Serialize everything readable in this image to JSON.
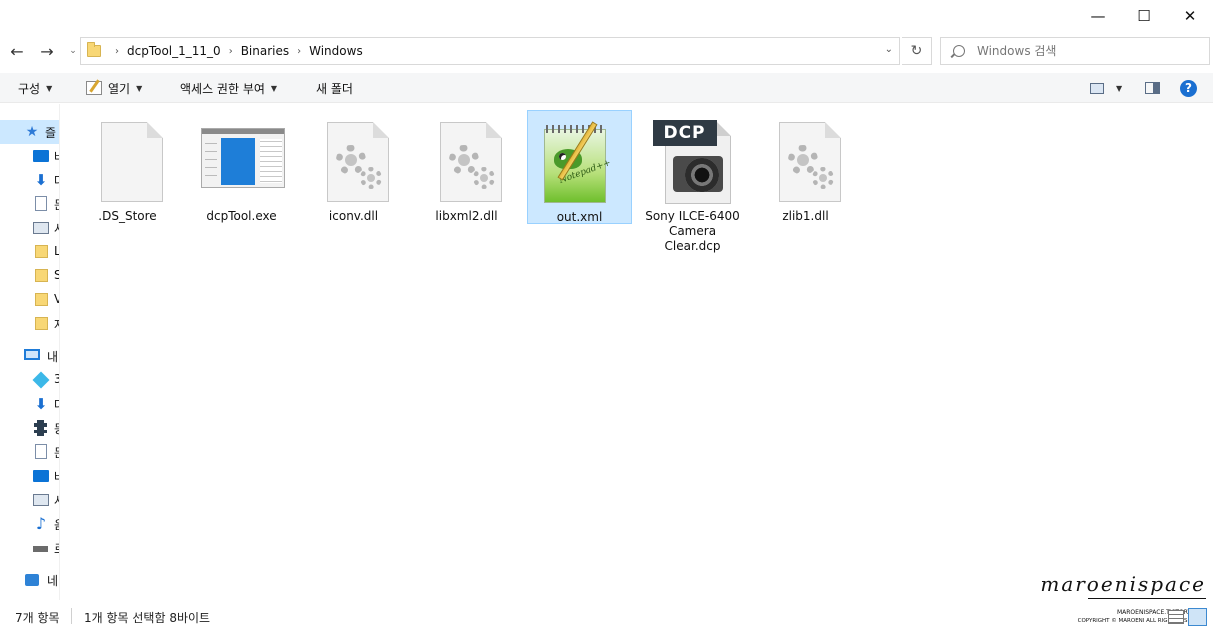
{
  "window": {
    "minimize_glyph": "—",
    "maximize_glyph": "☐",
    "close_glyph": "✕"
  },
  "nav": {
    "back_glyph": "←",
    "forward_glyph": "→",
    "recent_glyph": "⌄",
    "refresh_glyph": "↻",
    "dropdown_glyph": "⌄"
  },
  "address": {
    "breadcrumb": [
      "dcpTool_1_11_0",
      "Binaries",
      "Windows"
    ],
    "separator": "›"
  },
  "search": {
    "placeholder": "Windows 검색"
  },
  "toolbar": {
    "organize": "구성",
    "open": "열기",
    "access": "액세스 권한 부여",
    "new_folder": "새 폴더",
    "help": "?"
  },
  "sidebar": {
    "items": [
      {
        "label": "즐",
        "icon": "star-icon",
        "selected": true
      },
      {
        "label": "바",
        "icon": "desktop-icon"
      },
      {
        "label": "다",
        "icon": "download-icon"
      },
      {
        "label": "문",
        "icon": "document-icon"
      },
      {
        "label": "사",
        "icon": "pictures-icon"
      },
      {
        "label": "L",
        "icon": "folder-icon"
      },
      {
        "label": "S",
        "icon": "folder-icon"
      },
      {
        "label": "V",
        "icon": "folder-icon"
      },
      {
        "label": "자",
        "icon": "folder-icon"
      },
      {
        "label": "내",
        "icon": "computer-icon"
      },
      {
        "label": "3",
        "icon": "3d-objects-icon"
      },
      {
        "label": "다",
        "icon": "download-icon"
      },
      {
        "label": "동",
        "icon": "video-icon"
      },
      {
        "label": "문",
        "icon": "document-icon"
      },
      {
        "label": "바",
        "icon": "desktop-icon"
      },
      {
        "label": "사",
        "icon": "pictures-icon"
      },
      {
        "label": "음",
        "icon": "music-icon"
      },
      {
        "label": "로",
        "icon": "drive-icon"
      },
      {
        "label": "네",
        "icon": "network-icon"
      }
    ]
  },
  "files": [
    {
      "name": ".DS_Store",
      "icon": "blank-file-icon",
      "selected": false
    },
    {
      "name": "dcpTool.exe",
      "icon": "exe-icon",
      "selected": false
    },
    {
      "name": "iconv.dll",
      "icon": "dll-gear-icon",
      "selected": false
    },
    {
      "name": "libxml2.dll",
      "icon": "dll-gear-icon",
      "selected": false
    },
    {
      "name": "out.xml",
      "icon": "notepad-plus-plus-icon",
      "selected": true
    },
    {
      "name": "Sony ILCE-6400 Camera Clear.dcp",
      "icon": "dcp-camera-icon",
      "selected": false
    },
    {
      "name": "zlib1.dll",
      "icon": "dll-gear-icon",
      "selected": false
    }
  ],
  "icon_text": {
    "dcp_tag": "DCP",
    "npp_text": "Notepad++"
  },
  "status": {
    "item_count": "7개 항목",
    "selection": "1개 항목 선택함 8바이트"
  },
  "watermark": {
    "logo": "maroenispace",
    "url": "MAROENISPACE.TISTORY.COM",
    "copyright": "COPYRIGHT © MAROENI ALL RIGHT RESERVED"
  },
  "colors": {
    "selection_bg": "#cce8ff",
    "selection_border": "#99d1ff",
    "toolbar_bg": "#f5f6f7",
    "accent": "#1a6fd1"
  }
}
